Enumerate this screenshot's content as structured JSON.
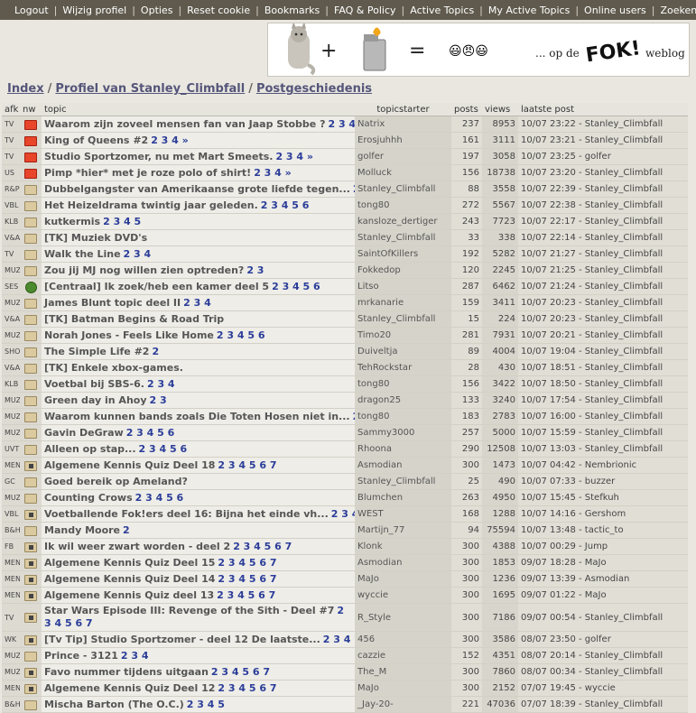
{
  "nav": [
    "Logout",
    "Wijzig profiel",
    "Opties",
    "Reset cookie",
    "Bookmarks",
    "FAQ & Policy",
    "Active Topics",
    "My Active Topics",
    "Online users",
    "Zoeken"
  ],
  "banner": {
    "plus": "+",
    "equals": "=",
    "smileys": "😃😠😃",
    "caption": "... op de",
    "logo_text": "FOK!",
    "suffix": "weblog"
  },
  "breadcrumb": [
    "Index",
    "Profiel van Stanley_Climbfall",
    "Postgeschiedenis"
  ],
  "columns": {
    "afk": "afk",
    "nw": "nw",
    "topic": "topic",
    "starter": "topicstarter",
    "posts": "posts",
    "views": "views",
    "last": "laatste post"
  },
  "rows": [
    {
      "afk": "TV",
      "icon": "hot",
      "title": "Waarom zijn zoveel mensen fan van Jaap Stobbe ?",
      "pages": "2 3 4 5 »",
      "starter": "Natrix",
      "posts": "237",
      "views": "8953",
      "last": "10/07 23:22 - Stanley_Climbfall"
    },
    {
      "afk": "TV",
      "icon": "hot",
      "title": "King of Queens #2",
      "pages": "2 3 4 »",
      "starter": "Erosjuhhh",
      "posts": "161",
      "views": "3111",
      "last": "10/07 23:21 - Stanley_Climbfall"
    },
    {
      "afk": "TV",
      "icon": "hot",
      "title": "Studio Sportzomer, nu met Mart Smeets.",
      "pages": "2 3 4 »",
      "starter": "golfer",
      "posts": "197",
      "views": "3058",
      "last": "10/07 23:25 - golfer"
    },
    {
      "afk": "US",
      "icon": "hot",
      "title": "Pimp *hier* met je roze polo of shirt!",
      "pages": "2 3 4 »",
      "starter": "Molluck",
      "posts": "156",
      "views": "18738",
      "last": "10/07 23:20 - Stanley_Climbfall"
    },
    {
      "afk": "R&P",
      "icon": "folder",
      "title": "Dubbelgangster van Amerikaanse grote liefde tegen...",
      "pages": "2",
      "starter": "Stanley_Climbfall",
      "posts": "88",
      "views": "3558",
      "last": "10/07 22:39 - Stanley_Climbfall"
    },
    {
      "afk": "VBL",
      "icon": "folder",
      "title": "Het Heizeldrama twintig jaar geleden.",
      "pages": "2 3 4 5 6",
      "starter": "tong80",
      "posts": "272",
      "views": "5567",
      "last": "10/07 22:38 - Stanley_Climbfall"
    },
    {
      "afk": "KLB",
      "icon": "folder",
      "title": "kutkermis",
      "pages": "2 3 4 5",
      "starter": "kansloze_dertiger",
      "posts": "243",
      "views": "7723",
      "last": "10/07 22:17 - Stanley_Climbfall"
    },
    {
      "afk": "V&A",
      "icon": "folder",
      "title": "[TK] Muziek DVD's",
      "pages": "",
      "starter": "Stanley_Climbfall",
      "posts": "33",
      "views": "338",
      "last": "10/07 22:14 - Stanley_Climbfall"
    },
    {
      "afk": "TV",
      "icon": "folder",
      "title": "Walk the Line",
      "pages": "2 3 4",
      "starter": "SaintOfKillers",
      "posts": "192",
      "views": "5282",
      "last": "10/07 21:27 - Stanley_Climbfall"
    },
    {
      "afk": "MUZ",
      "icon": "folder",
      "title": "Zou jij MJ nog willen zien optreden?",
      "pages": "2 3",
      "starter": "Fokkedop",
      "posts": "120",
      "views": "2245",
      "last": "10/07 21:25 - Stanley_Climbfall"
    },
    {
      "afk": "SES",
      "icon": "circle",
      "title": "[Centraal] Ik zoek/heb een kamer deel 5",
      "pages": "2 3 4 5 6",
      "starter": "Litso",
      "posts": "287",
      "views": "6462",
      "last": "10/07 21:24 - Stanley_Climbfall"
    },
    {
      "afk": "MUZ",
      "icon": "folder",
      "title": "James Blunt topic deel II",
      "pages": "2 3 4",
      "starter": "mrkanarie",
      "posts": "159",
      "views": "3411",
      "last": "10/07 20:23 - Stanley_Climbfall"
    },
    {
      "afk": "V&A",
      "icon": "folder",
      "title": "[TK] Batman Begins & Road Trip",
      "pages": "",
      "starter": "Stanley_Climbfall",
      "posts": "15",
      "views": "224",
      "last": "10/07 20:23 - Stanley_Climbfall"
    },
    {
      "afk": "MUZ",
      "icon": "folder",
      "title": "Norah Jones - Feels Like Home",
      "pages": "2 3 4 5 6",
      "starter": "Timo20",
      "posts": "281",
      "views": "7931",
      "last": "10/07 20:21 - Stanley_Climbfall"
    },
    {
      "afk": "SHO",
      "icon": "folder",
      "title": "The Simple Life #2",
      "pages": "2",
      "starter": "Duiveltja",
      "posts": "89",
      "views": "4004",
      "last": "10/07 19:04 - Stanley_Climbfall"
    },
    {
      "afk": "V&A",
      "icon": "folder",
      "title": "[TK] Enkele xbox-games.",
      "pages": "",
      "starter": "TehRockstar",
      "posts": "28",
      "views": "430",
      "last": "10/07 18:51 - Stanley_Climbfall"
    },
    {
      "afk": "KLB",
      "icon": "folder",
      "title": "Voetbal bij SBS-6.",
      "pages": "2 3 4",
      "starter": "tong80",
      "posts": "156",
      "views": "3422",
      "last": "10/07 18:50 - Stanley_Climbfall"
    },
    {
      "afk": "MUZ",
      "icon": "folder",
      "title": "Green day in Ahoy",
      "pages": "2 3",
      "starter": "dragon25",
      "posts": "133",
      "views": "3240",
      "last": "10/07 17:54 - Stanley_Climbfall"
    },
    {
      "afk": "MUZ",
      "icon": "folder",
      "title": "Waarom kunnen bands zoals Die Toten Hosen niet in...",
      "pages": "2 3 4",
      "starter": "tong80",
      "posts": "183",
      "views": "2783",
      "last": "10/07 16:00 - Stanley_Climbfall"
    },
    {
      "afk": "MUZ",
      "icon": "folder",
      "title": "Gavin DeGraw",
      "pages": "2 3 4 5 6",
      "starter": "Sammy3000",
      "posts": "257",
      "views": "5000",
      "last": "10/07 15:59 - Stanley_Climbfall"
    },
    {
      "afk": "UVT",
      "icon": "folder",
      "title": "Alleen op stap...",
      "pages": "2 3 4 5 6",
      "starter": "Rhoona",
      "posts": "290",
      "views": "12508",
      "last": "10/07 13:03 - Stanley_Climbfall"
    },
    {
      "afk": "MEN",
      "icon": "lock",
      "title": "Algemene Kennis Quiz Deel 18",
      "pages": "2 3 4 5 6 7",
      "starter": "Asmodian",
      "posts": "300",
      "views": "1473",
      "last": "10/07 04:42 - Nembrionic"
    },
    {
      "afk": "GC",
      "icon": "folder",
      "title": "Goed bereik op Ameland?",
      "pages": "",
      "starter": "Stanley_Climbfall",
      "posts": "25",
      "views": "490",
      "last": "10/07 07:33 - buzzer"
    },
    {
      "afk": "MUZ",
      "icon": "folder",
      "title": "Counting Crows",
      "pages": "2 3 4 5 6",
      "starter": "Blumchen",
      "posts": "263",
      "views": "4950",
      "last": "10/07 15:45 - Stefkuh"
    },
    {
      "afk": "VBL",
      "icon": "lock",
      "title": "Voetballende Fok!ers deel 16: Bijna het einde vh...",
      "pages": "2 3 4",
      "starter": "WEST",
      "posts": "168",
      "views": "1288",
      "last": "10/07 14:16 - Gershom"
    },
    {
      "afk": "B&H",
      "icon": "folder",
      "title": "Mandy Moore",
      "pages": "2",
      "starter": "Martijn_77",
      "posts": "94",
      "views": "75594",
      "last": "10/07 13:48 - tactic_to"
    },
    {
      "afk": "FB",
      "icon": "lock",
      "title": "Ik wil weer zwart worden - deel 2",
      "pages": "2 3 4 5 6 7",
      "starter": "Klonk",
      "posts": "300",
      "views": "4388",
      "last": "10/07 00:29 - Jump"
    },
    {
      "afk": "MEN",
      "icon": "lock",
      "title": "Algemene Kennis Quiz Deel 15",
      "pages": "2 3 4 5 6 7",
      "starter": "Asmodian",
      "posts": "300",
      "views": "1853",
      "last": "09/07 18:28 - MaJo"
    },
    {
      "afk": "MEN",
      "icon": "lock",
      "title": "Algemene Kennis Quiz Deel 14",
      "pages": "2 3 4 5 6 7",
      "starter": "MaJo",
      "posts": "300",
      "views": "1236",
      "last": "09/07 13:39 - Asmodian"
    },
    {
      "afk": "MEN",
      "icon": "lock",
      "title": "Algemene Kennis Quiz deel 13",
      "pages": "2 3 4 5 6 7",
      "starter": "wyccie",
      "posts": "300",
      "views": "1695",
      "last": "09/07 01:22 - MaJo"
    },
    {
      "afk": "TV",
      "icon": "lock",
      "title": "Star Wars Episode III: Revenge of the Sith - Deel #7",
      "pages": "2 3 4 5 6 7",
      "starter": "R_Style",
      "posts": "300",
      "views": "7186",
      "last": "09/07 00:54 - Stanley_Climbfall",
      "tall": true
    },
    {
      "afk": "WK",
      "icon": "lock",
      "title": "[Tv Tip] Studio Sportzomer - deel 12 De laatste...",
      "pages": "2 3 4 5 6 7",
      "starter": "456",
      "posts": "300",
      "views": "3586",
      "last": "08/07 23:50 - golfer"
    },
    {
      "afk": "MUZ",
      "icon": "folder",
      "title": "Prince - 3121",
      "pages": "2 3 4",
      "starter": "cazzie",
      "posts": "152",
      "views": "4351",
      "last": "08/07 20:14 - Stanley_Climbfall"
    },
    {
      "afk": "MUZ",
      "icon": "lock",
      "title": "Favo nummer tijdens uitgaan",
      "pages": "2 3 4 5 6 7",
      "starter": "The_M",
      "posts": "300",
      "views": "7860",
      "last": "08/07 00:34 - Stanley_Climbfall"
    },
    {
      "afk": "MEN",
      "icon": "lock",
      "title": "Algemene Kennis Quiz Deel 12",
      "pages": "2 3 4 5 6 7",
      "starter": "MaJo",
      "posts": "300",
      "views": "2152",
      "last": "07/07 19:45 - wyccie"
    },
    {
      "afk": "B&H",
      "icon": "folder",
      "title": "Mischa Barton (The O.C.)",
      "pages": "2 3 4 5",
      "starter": "_Jay-20-",
      "posts": "221",
      "views": "47036",
      "last": "07/07 18:39 - Stanley_Climbfall"
    }
  ]
}
